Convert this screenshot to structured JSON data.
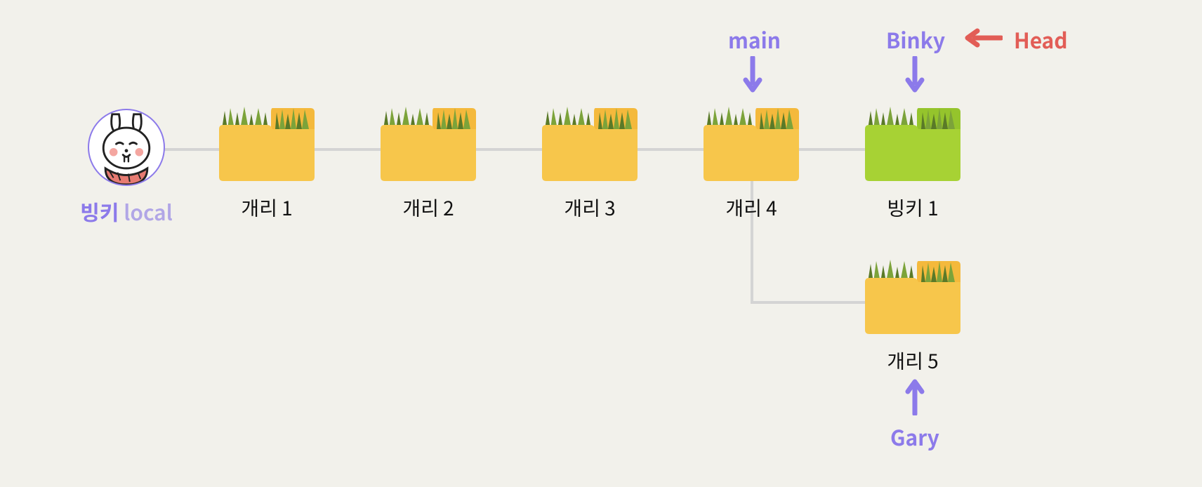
{
  "user": {
    "name": "빙키",
    "sub": "local"
  },
  "commits": [
    {
      "id": "c1",
      "label": "개리 1",
      "color": "yellow"
    },
    {
      "id": "c2",
      "label": "개리 2",
      "color": "yellow"
    },
    {
      "id": "c3",
      "label": "개리 3",
      "color": "yellow"
    },
    {
      "id": "c4",
      "label": "개리 4",
      "color": "yellow"
    },
    {
      "id": "c5",
      "label": "빙키 1",
      "color": "green"
    },
    {
      "id": "c6",
      "label": "개리 5",
      "color": "yellow"
    }
  ],
  "branches": {
    "main": "main",
    "binky": "Binky",
    "gary": "Gary"
  },
  "head": "Head",
  "colors": {
    "folder_yellow": "#f7c64b",
    "folder_yellow_tab": "#f4b93c",
    "folder_green": "#a7d234",
    "folder_green_tab": "#95c42c",
    "grass_dark": "#5a7a28",
    "grass_light": "#7ca33a",
    "purple": "#8c7aea",
    "red": "#e25d56",
    "line": "#d4d4d4"
  }
}
